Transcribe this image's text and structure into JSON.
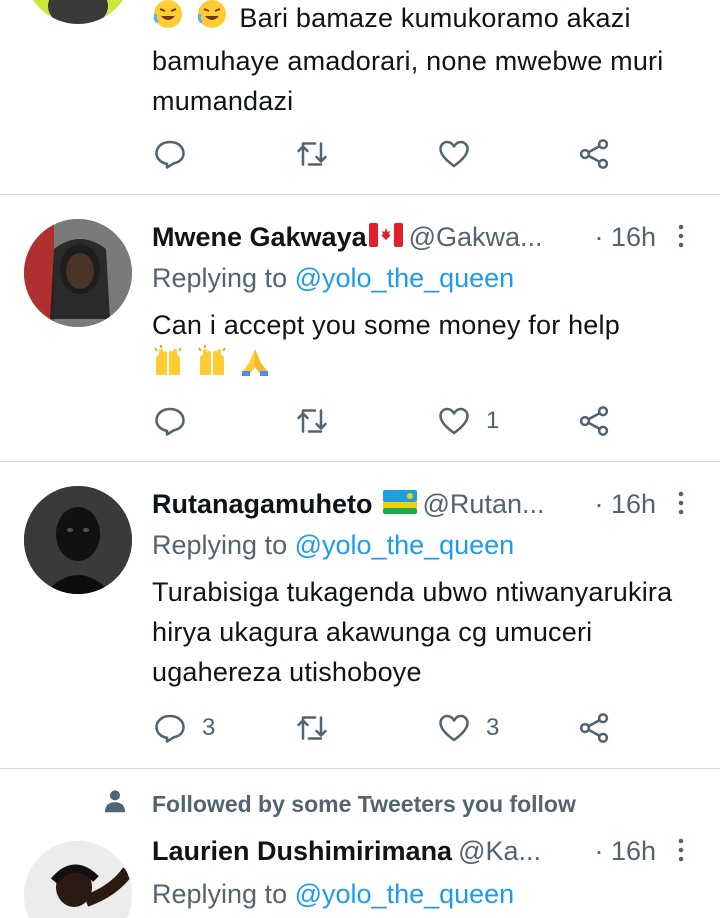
{
  "tweet0": {
    "text": "Bari bamaze kumukoramo akazi bamuhaye amadorari, none mwebwe muri mumandazi",
    "emoji": [
      "rolling-laughing-emoji",
      "rolling-laughing-emoji"
    ]
  },
  "tweet1": {
    "name": "Mwene Gakwaya",
    "name_flag": "canada-flag-emoji",
    "handle": "@Gakwa...",
    "time": "· 16h",
    "replying_prefix": "Replying to",
    "replying_to": "@yolo_the_queen",
    "text": "Can i accept you some money for help",
    "emoji": [
      "raising-hands-emoji",
      "raising-hands-emoji",
      "folded-hands-emoji"
    ],
    "likes": "1"
  },
  "tweet2": {
    "name": "Rutanagamuheto",
    "name_flag": "rwanda-flag-emoji",
    "handle": "@Rutan...",
    "time": "· 16h",
    "replying_prefix": "Replying to",
    "replying_to": "@yolo_the_queen",
    "text": "Turabisiga tukagenda ubwo ntiwanyarukira hirya ukagura akawunga cg umuceri ugahereza utishoboye",
    "replies": "3",
    "likes": "3"
  },
  "tweet3": {
    "social_context": "Followed by some Tweeters you follow",
    "name": "Laurien Dushimirimana",
    "handle": "@Ka...",
    "time": "· 16h",
    "replying_prefix": "Replying to",
    "replying_to": "@yolo_the_queen"
  },
  "colors": {
    "accent": "#1d9bf0",
    "secondary": "#536471",
    "divider": "#cfd9de"
  }
}
